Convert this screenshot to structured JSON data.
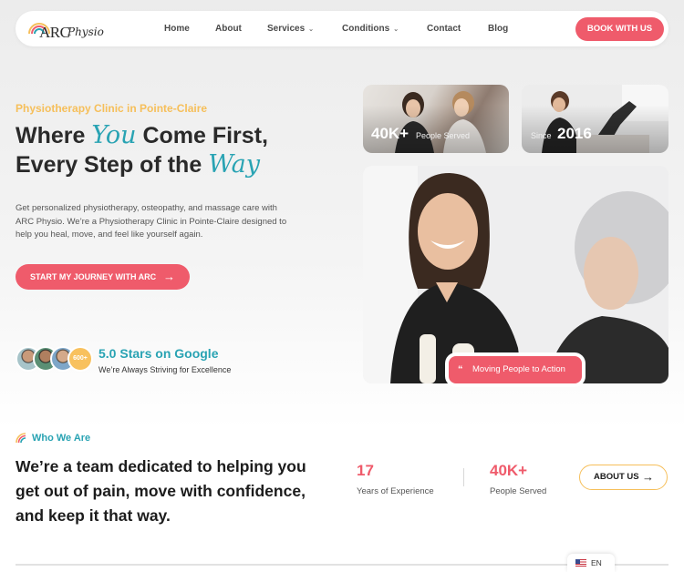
{
  "brand": {
    "logo_text": "ARC",
    "logo_script": "Physio",
    "colors": {
      "coral": "#ef5b6b",
      "teal": "#29a3b3",
      "yellow": "#f6bf5a"
    }
  },
  "nav": {
    "items": [
      {
        "label": "Home",
        "dropdown": false
      },
      {
        "label": "About",
        "dropdown": false
      },
      {
        "label": "Services",
        "dropdown": true
      },
      {
        "label": "Conditions",
        "dropdown": true
      },
      {
        "label": "Contact",
        "dropdown": false
      },
      {
        "label": "Blog",
        "dropdown": false
      }
    ],
    "cta": "BOOK WITH US"
  },
  "hero": {
    "eyebrow": "Physiotherapy Clinic in Pointe-Claire",
    "headline_line1_a": "Where",
    "headline_line1_script": "You",
    "headline_line1_b": "Come First,",
    "headline_line2_a": "Every Step of the",
    "headline_line2_script": "Way",
    "description": "Get personalized physiotherapy, osteopathy, and massage care with ARC Physio. We’re a Physiotherapy Clinic in Pointe-Claire designed to help you heal, move, and feel like yourself again.",
    "cta": "START MY JOURNEY WITH ARC",
    "rating": {
      "badge": "600+",
      "title": "5.0 Stars on Google",
      "subtitle": "We’re Always Striving for Excellence"
    },
    "photo_stats": [
      {
        "big": "40K+",
        "small": "People Served"
      },
      {
        "small": "Since",
        "big": "2016"
      }
    ],
    "tag": "Moving People to Action"
  },
  "who": {
    "label": "Who We Are",
    "headline": "We’re a team dedicated to helping you get out of pain, move with confidence, and keep it that way.",
    "stats": [
      {
        "value": "17",
        "label": "Years of Experience"
      },
      {
        "value": "40K+",
        "label": "People Served"
      }
    ],
    "button": "ABOUT US"
  },
  "language": {
    "code": "EN",
    "flag_icon": "us-flag-icon"
  }
}
